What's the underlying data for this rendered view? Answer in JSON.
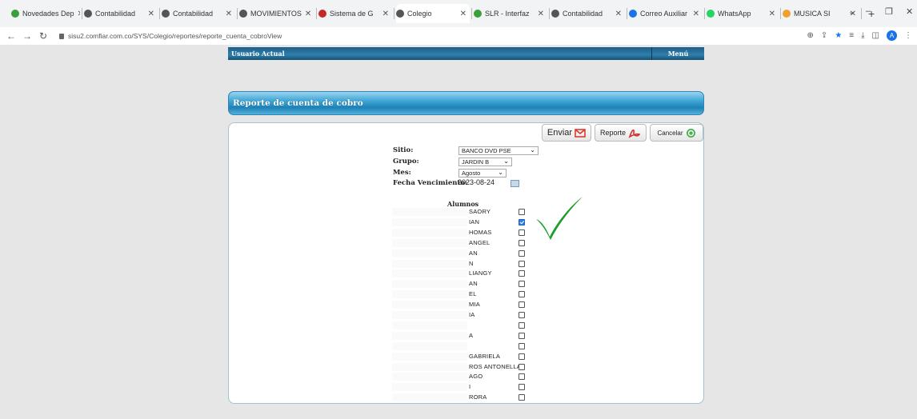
{
  "browser": {
    "tabs": [
      {
        "title": "Novedades Dep",
        "color": "#3c9e3c"
      },
      {
        "title": "Contabilidad",
        "color": "#555555"
      },
      {
        "title": "Contabilidad",
        "color": "#555555"
      },
      {
        "title": "MOVIMIENTOS",
        "color": "#555555"
      },
      {
        "title": "Sistema de G",
        "color": "#c62828"
      },
      {
        "title": "Colegio",
        "color": "#555555",
        "active": true
      },
      {
        "title": "SLR - Interfaz",
        "color": "#3c9e3c"
      },
      {
        "title": "Contabilidad",
        "color": "#555555"
      },
      {
        "title": "Correo Auxiliar",
        "color": "#1a73e8"
      },
      {
        "title": "WhatsApp",
        "color": "#25d366"
      },
      {
        "title": "MUSICA SI",
        "color": "#f0a030"
      }
    ],
    "url": "sisu2.comfiar.com.co/SYS/Colegio/reportes/reporte_cuenta_cobroView"
  },
  "header": {
    "user_label": "Usuario Actual",
    "menu_label": "Menú"
  },
  "report": {
    "title": "Reporte de cuenta de cobro",
    "enviar_label": "Enviar",
    "reporte_label": "Reporte",
    "cancelar_label": "Cancelar"
  },
  "form": {
    "sitio_label": "Sitio:",
    "sitio_value": "BANCO DVD PSE",
    "grupo_label": "Grupo:",
    "grupo_value": "JARDIN B",
    "mes_label": "Mes:",
    "mes_value": "Agosto",
    "fecha_label": "Fecha Vencimiento:",
    "fecha_value": "2023-08-24"
  },
  "alumnos": {
    "title": "Alumnos",
    "students": [
      {
        "name": "SAORY",
        "checked": false
      },
      {
        "name": "IAN",
        "checked": true
      },
      {
        "name": "HOMAS",
        "checked": false
      },
      {
        "name": "ANGEL",
        "checked": false
      },
      {
        "name": "AN",
        "checked": false
      },
      {
        "name": "N",
        "checked": false
      },
      {
        "name": "LIANGY",
        "checked": false
      },
      {
        "name": "AN",
        "checked": false
      },
      {
        "name": "EL",
        "checked": false
      },
      {
        "name": "MIA",
        "checked": false
      },
      {
        "name": "IA",
        "checked": false
      },
      {
        "name": "",
        "checked": false
      },
      {
        "name": "A",
        "checked": false
      },
      {
        "name": "",
        "checked": false
      },
      {
        "name": "GABRIELA",
        "checked": false
      },
      {
        "name": "ROS ANTONELLA",
        "checked": false
      },
      {
        "name": "AGO",
        "checked": false
      },
      {
        "name": "I",
        "checked": false
      },
      {
        "name": "RORA",
        "checked": false
      }
    ]
  },
  "colors": {
    "accent_blue": "#1e82b6",
    "check_green": "#1f9e2c"
  }
}
